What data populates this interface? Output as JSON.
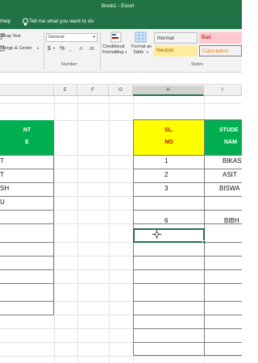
{
  "window": {
    "title": "Book1 - Excel"
  },
  "menu": {
    "help": "Help",
    "tell_me": "Tell me what you want to do"
  },
  "ribbon": {
    "wrap_text": "Wrap Text",
    "merge_center": "Merge & Center",
    "number_format": "General",
    "currency": "$",
    "percent": "%",
    "comma": ",",
    "conditional_formatting": [
      "Conditional",
      "Formatting"
    ],
    "format_as_table": [
      "Format as",
      "Table"
    ],
    "number_group": "Number",
    "styles_group": "Styles",
    "styles": [
      {
        "name": "Normal",
        "bg": "#ffffff",
        "fg": "#222222"
      },
      {
        "name": "Bad",
        "bg": "#ffc7ce",
        "fg": "#9c0006"
      },
      {
        "name": "Neutral",
        "bg": "#ffeb9c",
        "fg": "#9c5700"
      },
      {
        "name": "Calculation",
        "bg": "#f2f2f2",
        "fg": "#fa7d00"
      }
    ]
  },
  "columns": {
    "headers": [
      "E",
      "F",
      "G",
      "H",
      "I"
    ],
    "selected": "H"
  },
  "left_table": {
    "header_line1": "NT",
    "header_line2": "E",
    "header_color": "#00b050",
    "rows": [
      "T",
      "T",
      "SH",
      "U"
    ]
  },
  "right_table": {
    "sl_header": [
      "SL.",
      "NO"
    ],
    "sl_header_color": "#ffff00",
    "sl_header_text_color": "#c00000",
    "name_header": [
      "STUDE",
      "NAM"
    ],
    "name_header_color": "#00b050",
    "rows": [
      {
        "sl": "1",
        "name": "BIKAS"
      },
      {
        "sl": "2",
        "name": "ASIT"
      },
      {
        "sl": "3",
        "name": "BISWA"
      },
      {
        "sl": "",
        "name": ""
      },
      {
        "sl": "6",
        "name": "BIBH"
      }
    ]
  },
  "colors": {
    "excel_green": "#217346"
  }
}
